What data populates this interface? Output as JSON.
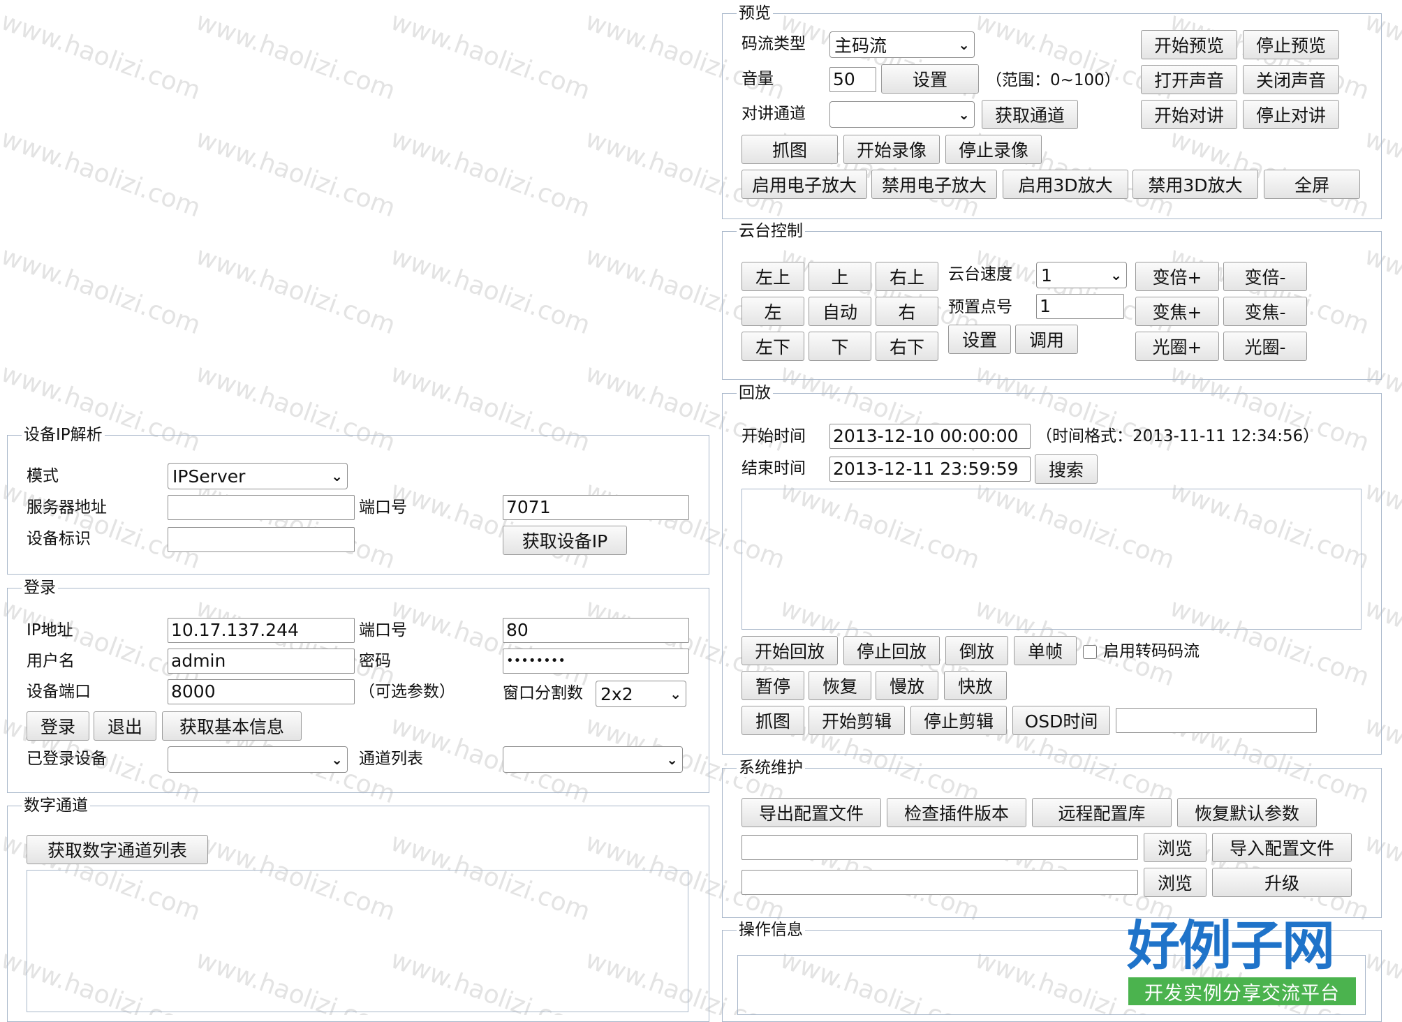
{
  "watermark": {
    "text": "www.haolizi.com"
  },
  "ipparse": {
    "legend": "设备IP解析",
    "mode_label": "模式",
    "mode_value": "IPServer",
    "server_label": "服务器地址",
    "server_value": "",
    "port_label": "端口号",
    "port_value": "7071",
    "devid_label": "设备标识",
    "devid_value": "",
    "get_ip_btn": "获取设备IP"
  },
  "login": {
    "legend": "登录",
    "ip_label": "IP地址",
    "ip_value": "10.17.137.244",
    "port_label": "端口号",
    "port_value": "80",
    "user_label": "用户名",
    "user_value": "admin",
    "pwd_label": "密码",
    "pwd_value": "••••••••",
    "devport_label": "设备端口",
    "devport_value": "8000",
    "optional": "（可选参数）",
    "split_label": "窗口分割数",
    "split_value": "2x2",
    "login_btn": "登录",
    "logout_btn": "退出",
    "info_btn": "获取基本信息",
    "logged_label": "已登录设备",
    "logged_value": "",
    "channels_label": "通道列表",
    "channels_value": ""
  },
  "digital": {
    "legend": "数字通道",
    "get_btn": "获取数字通道列表"
  },
  "preview": {
    "legend": "预览",
    "stream_label": "码流类型",
    "stream_value": "主码流",
    "volume_label": "音量",
    "volume_value": "50",
    "set_btn": "设置",
    "range": "（范围：0~100）",
    "talk_label": "对讲通道",
    "talk_value": "",
    "get_channel_btn": "获取通道",
    "start_preview": "开始预览",
    "stop_preview": "停止预览",
    "open_sound": "打开声音",
    "close_sound": "关闭声音",
    "start_talk": "开始对讲",
    "stop_talk": "停止对讲",
    "capture": "抓图",
    "start_record": "开始录像",
    "stop_record": "停止录像",
    "enable_ezoom": "启用电子放大",
    "disable_ezoom": "禁用电子放大",
    "enable_3d": "启用3D放大",
    "disable_3d": "禁用3D放大",
    "fullscreen": "全屏"
  },
  "ptz": {
    "legend": "云台控制",
    "upleft": "左上",
    "up": "上",
    "upright": "右上",
    "left": "左",
    "auto": "自动",
    "right": "右",
    "downleft": "左下",
    "down": "下",
    "downright": "右下",
    "speed_label": "云台速度",
    "speed_value": "1",
    "preset_label": "预置点号",
    "preset_value": "1",
    "set_btn": "设置",
    "call_btn": "调用",
    "zoom_in": "变倍+",
    "zoom_out": "变倍-",
    "focus_in": "变焦+",
    "focus_out": "变焦-",
    "iris_in": "光圈+",
    "iris_out": "光圈-"
  },
  "playback": {
    "legend": "回放",
    "start_label": "开始时间",
    "start_value": "2013-12-10 00:00:00",
    "format_hint": "（时间格式：2013-11-11 12:34:56）",
    "end_label": "结束时间",
    "end_value": "2013-12-11 23:59:59",
    "search_btn": "搜索",
    "start_play": "开始回放",
    "stop_play": "停止回放",
    "reverse": "倒放",
    "single_frame": "单帧",
    "transcode_label": "启用转码码流",
    "pause": "暂停",
    "resume": "恢复",
    "slow": "慢放",
    "fast": "快放",
    "capture": "抓图",
    "start_clip": "开始剪辑",
    "stop_clip": "停止剪辑",
    "osd_btn": "OSD时间",
    "osd_value": ""
  },
  "maintenance": {
    "legend": "系统维护",
    "export_cfg": "导出配置文件",
    "check_plugin": "检查插件版本",
    "remote_cfg": "远程配置库",
    "restore_default": "恢复默认参数",
    "browse": "浏览",
    "import_cfg": "导入配置文件",
    "upgrade": "升级",
    "file1": "",
    "file2": ""
  },
  "oplog": {
    "legend": "操作信息"
  },
  "logo": {
    "main": "好例子网",
    "sub": "开发实例分享交流平台"
  }
}
